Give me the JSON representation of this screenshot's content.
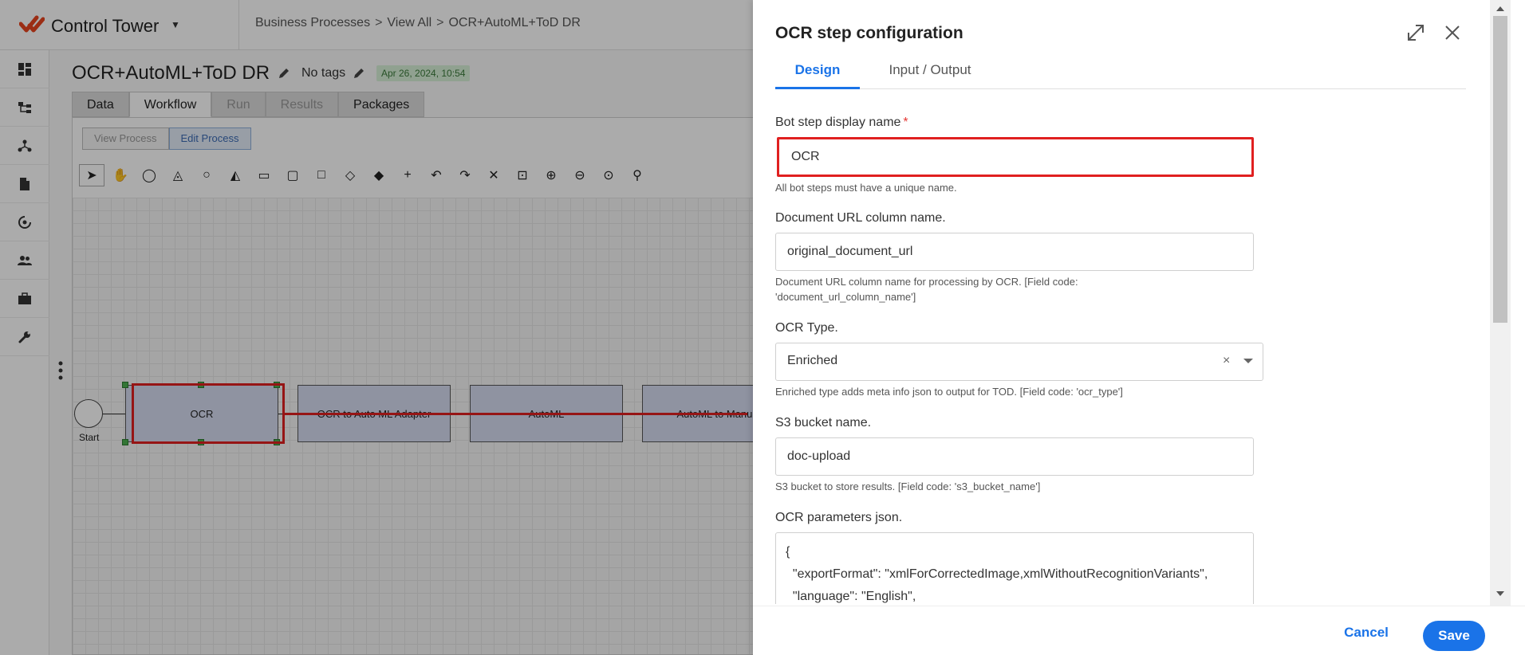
{
  "app": {
    "name": "Control Tower",
    "brand_color": "#e8441e",
    "accent_color": "#1a73e8",
    "highlight_color": "#e02020"
  },
  "breadcrumb": {
    "items": [
      "Business Processes",
      "View All",
      "OCR+AutoML+ToD DR"
    ],
    "separator": ">"
  },
  "sidenav": {
    "icons": [
      "dashboard-icon",
      "hierarchy-icon",
      "network-icon",
      "document-icon",
      "sync-icon",
      "users-icon",
      "briefcase-icon",
      "wrench-icon"
    ]
  },
  "process": {
    "title": "OCR+AutoML+ToD DR",
    "tags": "No tags",
    "date": "Apr 26, 2024, 10:54",
    "tabs": [
      "Data",
      "Workflow",
      "Run",
      "Results",
      "Packages"
    ],
    "active_tab": "Workflow",
    "disabled_tabs": [
      "Run",
      "Results"
    ],
    "modes": [
      "View Process",
      "Edit Process"
    ],
    "active_mode": "Edit Process"
  },
  "workflow": {
    "start_label": "Start",
    "nodes": [
      "OCR",
      "OCR to Auto ML Adapter",
      "AutoML",
      "AutoML to Manual"
    ]
  },
  "drawer": {
    "title": "OCR step configuration",
    "tabs": [
      "Design",
      "Input / Output"
    ],
    "active_tab": "Design",
    "fields": {
      "name": {
        "label": "Bot step display name",
        "required_mark": "*",
        "value": "OCR",
        "help": "All bot steps must have a unique name."
      },
      "doc_url": {
        "label": "Document URL column name.",
        "value": "original_document_url",
        "help_line1": "Document URL column name for processing by OCR. [Field code:",
        "help_line2": "'document_url_column_name']"
      },
      "ocr_type": {
        "label": "OCR Type.",
        "value": "Enriched",
        "clear": "×",
        "help": "Enriched type adds meta info json to output for TOD. [Field code: 'ocr_type']"
      },
      "s3": {
        "label": "S3 bucket name.",
        "value": "doc-upload",
        "help": "S3 bucket to store results. [Field code: 's3_bucket_name']"
      },
      "ocr_params": {
        "label": "OCR parameters json.",
        "lines": [
          "{",
          "  \"exportFormat\": \"xmlForCorrectedImage,xmlWithoutRecognitionVariants\",",
          "  \"language\": \"English\","
        ]
      }
    },
    "cancel_label": "Cancel",
    "save_label": "Save"
  }
}
